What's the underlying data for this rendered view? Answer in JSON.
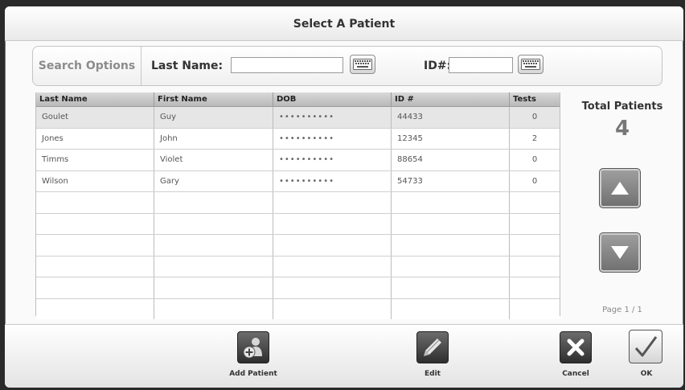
{
  "dialog": {
    "title": "Select A Patient"
  },
  "search": {
    "options_label": "Search Options",
    "last_name_label": "Last Name:",
    "last_name_value": "",
    "id_label": "ID#:",
    "id_value": ""
  },
  "table": {
    "headers": [
      "Last Name",
      "First Name",
      "DOB",
      "ID #",
      "Tests"
    ],
    "rows": [
      {
        "last": "Goulet",
        "first": "Guy",
        "dob": "••••••••••",
        "id": "44433",
        "tests": "0"
      },
      {
        "last": "Jones",
        "first": "John",
        "dob": "••••••••••",
        "id": "12345",
        "tests": "2"
      },
      {
        "last": "Timms",
        "first": "Violet",
        "dob": "••••••••••",
        "id": "88654",
        "tests": "0"
      },
      {
        "last": "Wilson",
        "first": "Gary",
        "dob": "••••••••••",
        "id": "54733",
        "tests": "0"
      }
    ],
    "selected_row_index": 0
  },
  "side": {
    "total_label": "Total Patients",
    "total_count": "4",
    "page_indicator": "Page 1 / 1"
  },
  "footer": {
    "add_label": "Add Patient",
    "edit_label": "Edit",
    "cancel_label": "Cancel",
    "ok_label": "OK"
  },
  "icons": {
    "keyboard": "keyboard-icon",
    "up": "arrow-up-icon",
    "down": "arrow-down-icon",
    "add": "add-person-icon",
    "edit": "pencil-icon",
    "cancel": "x-icon",
    "ok": "checkmark-icon"
  }
}
